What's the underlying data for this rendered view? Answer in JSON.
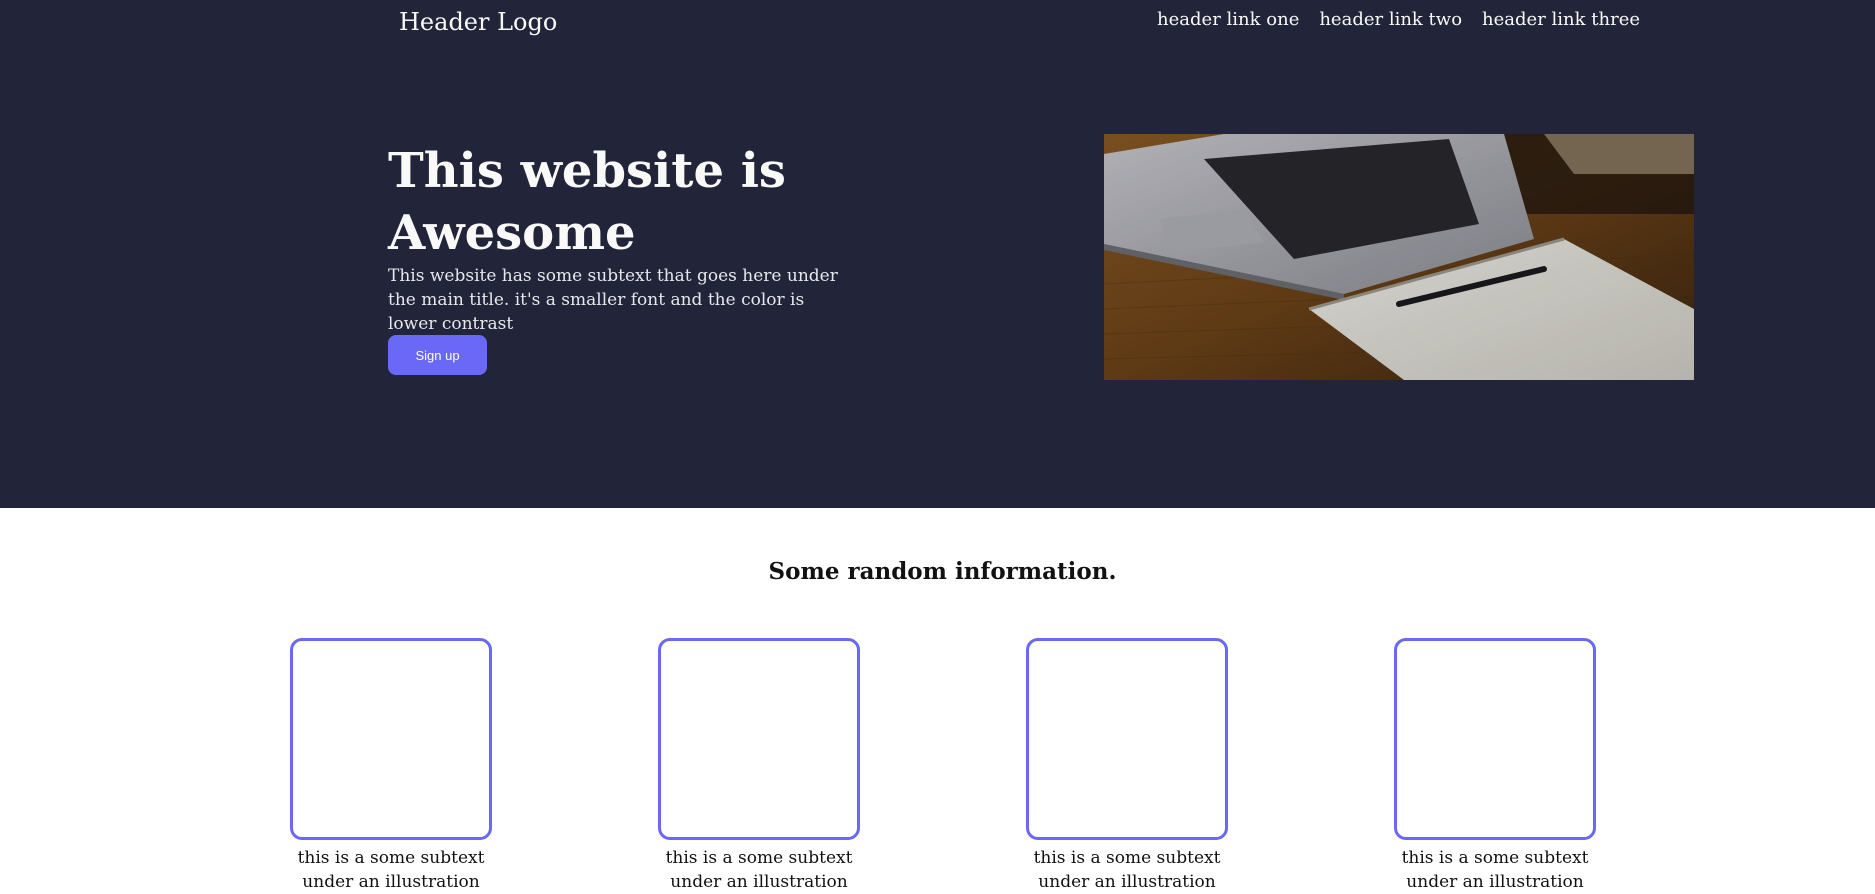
{
  "header": {
    "logo": "Header Logo",
    "links": [
      "header link one",
      "header link two",
      "header link three"
    ]
  },
  "hero": {
    "title": "This website is Awesome",
    "subtext": "This website has some subtext that goes here under the main title. it's a smaller font and the color is lower contrast",
    "signup_label": "Sign up",
    "image_icon": "laptop-notebook-photo"
  },
  "info": {
    "title": "Some random information.",
    "cards": [
      {
        "text": "this is a some subtext under an illustration"
      },
      {
        "text": "this is a some subtext under an illustration"
      },
      {
        "text": "this is a some subtext under an illustration"
      },
      {
        "text": "this is a some subtext under an illustration"
      }
    ]
  },
  "colors": {
    "hero_background": "#222539",
    "accent": "#6a68f6",
    "light_text": "#f9faf8"
  }
}
